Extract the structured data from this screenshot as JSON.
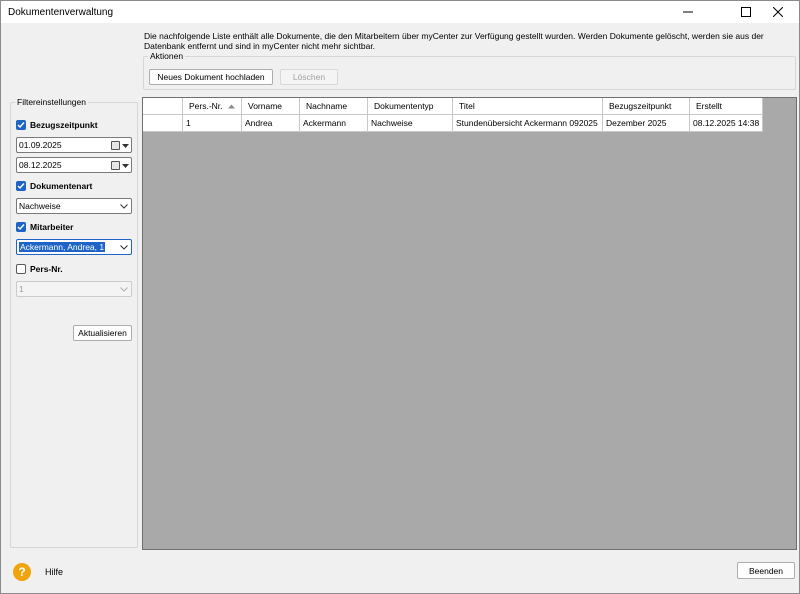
{
  "window": {
    "title": "Dokumentenverwaltung"
  },
  "description": "Die nachfolgende Liste enthält alle Dokumente, die den Mitarbeitern über myCenter zur Verfügung gestellt wurden. Werden Dokumente gelöscht, werden sie aus der Datenbank entfernt und sind in myCenter nicht mehr sichtbar.",
  "actions": {
    "legend": "Aktionen",
    "upload_label": "Neues  Dokument hochladen",
    "delete_label": "Löschen"
  },
  "filters": {
    "legend": "Filtereinstellungen",
    "bezugszeitpunkt": {
      "label": "Bezugszeitpunkt",
      "checked": true,
      "from": "01.09.2025",
      "to": "08.12.2025"
    },
    "dokumentenart": {
      "label": "Dokumentenart",
      "checked": true,
      "value": "Nachweise"
    },
    "mitarbeiter": {
      "label": "Mitarbeiter",
      "checked": true,
      "value": "Ackermann, Andrea, 1"
    },
    "persnr": {
      "label": "Pers-Nr.",
      "checked": false,
      "value": "1"
    },
    "refresh_label": "Aktualisieren"
  },
  "table": {
    "columns": [
      "Pers.-Nr.",
      "Vorname",
      "Nachname",
      "Dokumententyp",
      "Titel",
      "Bezugszeitpunkt",
      "Erstellt"
    ],
    "rows": [
      [
        "1",
        "Andrea",
        "Ackermann",
        "Nachweise",
        "Stundenübersicht  Ackermann 092025",
        "Dezember 2025",
        "08.12.2025 14:38"
      ]
    ]
  },
  "footer": {
    "help_label": "Hilfe",
    "help_glyph": "?",
    "quit_label": "Beenden"
  },
  "colors": {
    "accent": "#1d64c6",
    "help": "#f0a30a",
    "grid_bg": "#a9a9a9"
  }
}
